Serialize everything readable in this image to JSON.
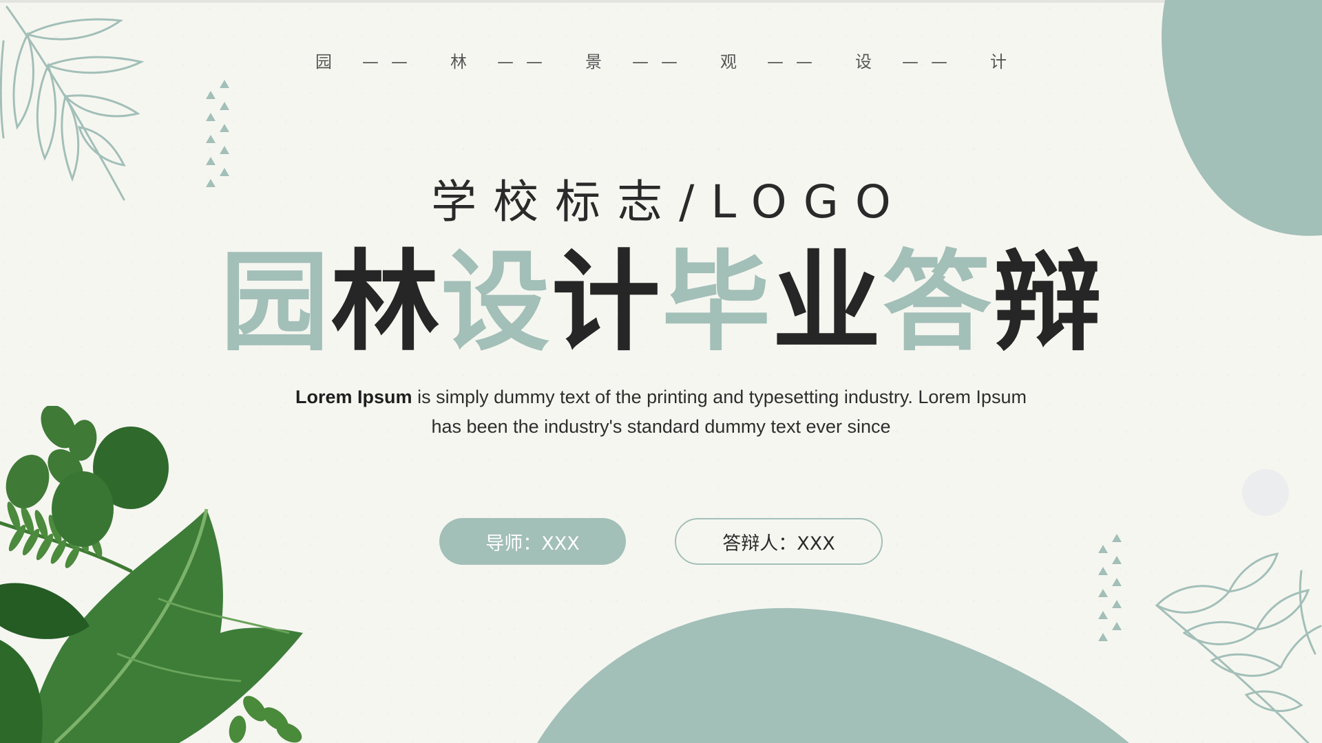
{
  "header": {
    "spaced_title_parts": [
      "园",
      "——",
      "林",
      "——",
      "景",
      "——",
      "观",
      "——",
      "设",
      "——",
      "计"
    ]
  },
  "logo_line": "学校标志/LOGO",
  "main_title": {
    "chars": [
      {
        "text": "园"
      },
      {
        "text": "林"
      },
      {
        "text": "设"
      },
      {
        "text": "计"
      },
      {
        "text": "毕"
      },
      {
        "text": "业"
      },
      {
        "text": "答"
      },
      {
        "text": "辩"
      }
    ]
  },
  "description": {
    "bold_lead": "Lorem Ipsum",
    "rest": " is simply dummy text of the printing and typesetting industry. Lorem Ipsum has been the industry's standard dummy text ever since"
  },
  "buttons": {
    "advisor": "导师：XXX",
    "defender": "答辩人：XXX"
  },
  "colors": {
    "accent": "#a2bfb8",
    "text_dark": "#262626",
    "background": "#f6f6f1",
    "leaf_green": "#3f7a37"
  },
  "icons": [
    "leaf-sketch-top-left",
    "leaf-sketch-bottom-right",
    "green-plant-photo",
    "triangle-pattern"
  ]
}
